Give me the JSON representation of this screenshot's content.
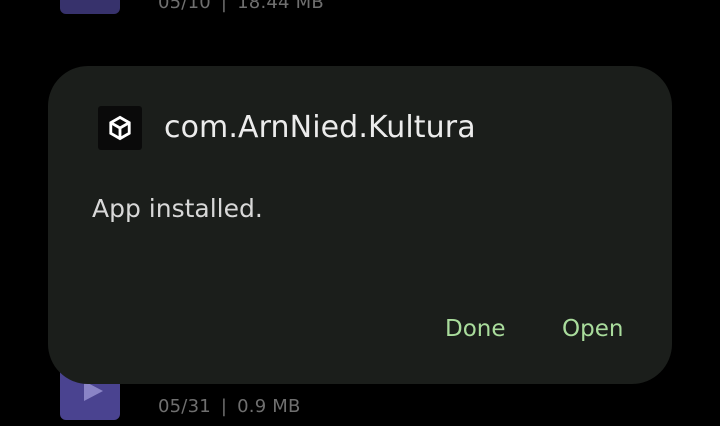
{
  "background": {
    "items": [
      {
        "date": "05/10",
        "separator": "|",
        "size": "18.44 MB"
      },
      {
        "date": "05/31",
        "separator": "|",
        "size": "0.9 MB"
      }
    ],
    "thumbnail_color": "#4a4390"
  },
  "dialog": {
    "app_icon": "unity-logo-icon",
    "app_name": "com.ArnNied.Kultura",
    "message": "App installed.",
    "buttons": {
      "done_label": "Done",
      "open_label": "Open"
    },
    "colors": {
      "background": "#1b1e1b",
      "accent": "#a9dc9c",
      "page": "#000000"
    }
  }
}
